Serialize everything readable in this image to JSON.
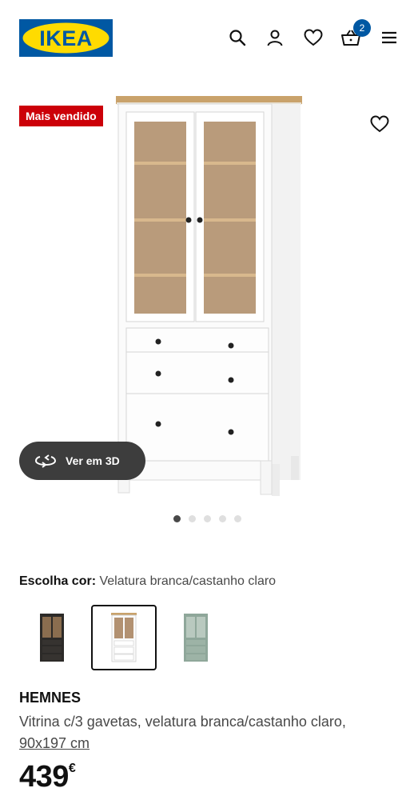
{
  "header": {
    "logo_text": "IKEA",
    "cart_count": "2",
    "icons": [
      "search-icon",
      "user-icon",
      "heart-icon",
      "basket-icon",
      "menu-icon"
    ]
  },
  "media": {
    "badge": "Mais vendido",
    "view_3d_label": "Ver em 3D",
    "slides_total": 5,
    "slide_active": 1
  },
  "color_chooser": {
    "label": "Escolha cor:",
    "selected_value": "Velatura branca/castanho claro",
    "swatches": [
      "black-brown",
      "white-light-brown",
      "grey-green"
    ],
    "selected_index": 1
  },
  "product": {
    "name": "HEMNES",
    "description": "Vitrina c/3 gavetas, velatura branca/castanho claro,",
    "size": "90x197 cm",
    "price": "439",
    "currency": "€"
  },
  "colors": {
    "brand_blue": "#0058a3",
    "brand_yellow": "#ffdb00",
    "badge_red": "#cc0008"
  }
}
